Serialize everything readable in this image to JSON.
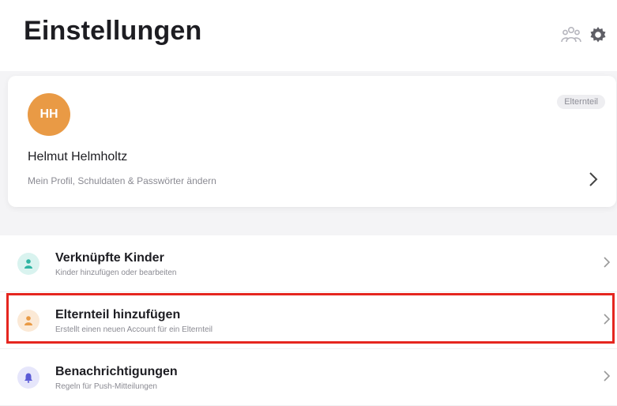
{
  "header": {
    "title": "Einstellungen",
    "icons": [
      "family-icon",
      "gear-icon"
    ]
  },
  "profile": {
    "initials": "HH",
    "name": "Helmut Helmholtz",
    "subtitle": "Mein Profil, Schuldaten & Passwörter ändern",
    "role": "Elternteil",
    "avatar_color": "#e99a45"
  },
  "menu": {
    "items": [
      {
        "title": "Verknüpfte Kinder",
        "subtitle": "Kinder hinzufügen oder bearbeiten",
        "icon": "child-icon",
        "icon_color": "#2fb5a3",
        "highlighted": false
      },
      {
        "title": "Elternteil hinzufügen",
        "subtitle": "Erstellt einen neuen Account für ein Elternteil",
        "icon": "person-icon",
        "icon_color": "#e99a45",
        "highlighted": true
      },
      {
        "title": "Benachrichtigungen",
        "subtitle": "Regeln für Push-Mitteilungen",
        "icon": "bell-icon",
        "icon_color": "#5b5bd6",
        "highlighted": false
      }
    ]
  },
  "colors": {
    "highlight_border": "#e5261f",
    "background": "#f4f4f6"
  }
}
